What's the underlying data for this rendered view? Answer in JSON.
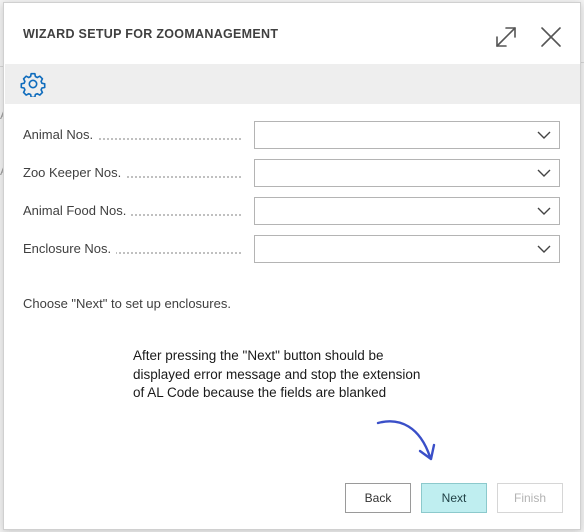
{
  "dialog": {
    "title": "WIZARD SETUP FOR ZOOMANAGEMENT"
  },
  "icons": {
    "expand": "expand-icon",
    "close": "close-icon",
    "settings": "gear-icon",
    "dropdown": "chevron-down-icon",
    "annotation_arrow": "curved-arrow-icon"
  },
  "fields": [
    {
      "label": "Animal Nos.",
      "value": ""
    },
    {
      "label": "Zoo Keeper Nos.",
      "value": ""
    },
    {
      "label": "Animal Food Nos.",
      "value": ""
    },
    {
      "label": "Enclosure Nos.",
      "value": ""
    }
  ],
  "instruction": "Choose \"Next\" to set up enclosures.",
  "annotation": "After pressing the \"Next\" button should be displayed error message and stop the extension of AL Code because the fields are blanked",
  "buttons": {
    "back": "Back",
    "next": "Next",
    "finish": "Finish"
  },
  "background": {
    "left_char_1": "A",
    "left_char_2": "A"
  },
  "colors": {
    "accent": "#0f6cbd",
    "next_bg": "#bfeef0",
    "annotation_arrow": "#3a4fc8"
  }
}
